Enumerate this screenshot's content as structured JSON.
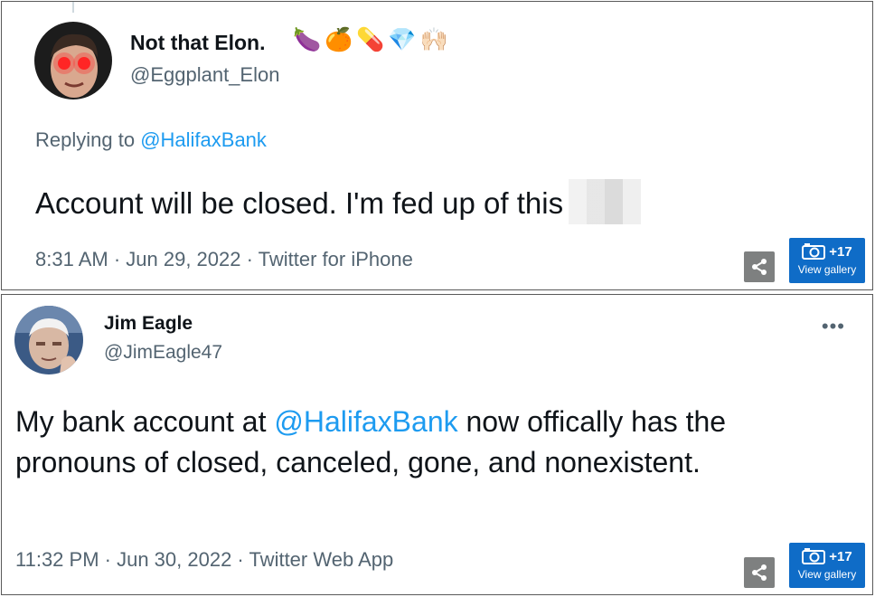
{
  "tweet1": {
    "name": "Not that Elon.",
    "handle": "@Eggplant_Elon",
    "emojis": [
      "🍆",
      "🍊",
      "💊",
      "💎",
      "🙌🏻"
    ],
    "reply_prefix": "Replying to ",
    "reply_mention": "@HalifaxBank",
    "text": "Account will be closed. I'm fed up of this",
    "meta": "8:31 AM · Jun 29, 2022 · Twitter for iPhone",
    "gallery_count": "+17",
    "gallery_label": "View gallery"
  },
  "tweet2": {
    "name": "Jim Eagle",
    "handle": "@JimEagle47",
    "more": "•••",
    "text_before": "My bank account at ",
    "text_mention": "@HalifaxBank",
    "text_after": " now offically has the pronouns of closed, canceled, gone, and nonexistent.",
    "meta": "11:32 PM · Jun 30, 2022 · Twitter Web App",
    "gallery_count": "+17",
    "gallery_label": "View gallery"
  },
  "colors": {
    "link": "#1d9bf0",
    "gallery": "#0f6cc7",
    "share": "#7e8080",
    "muted": "#536471"
  },
  "icons": {
    "share": "share-icon",
    "camera": "camera-icon",
    "more": "more-icon"
  }
}
